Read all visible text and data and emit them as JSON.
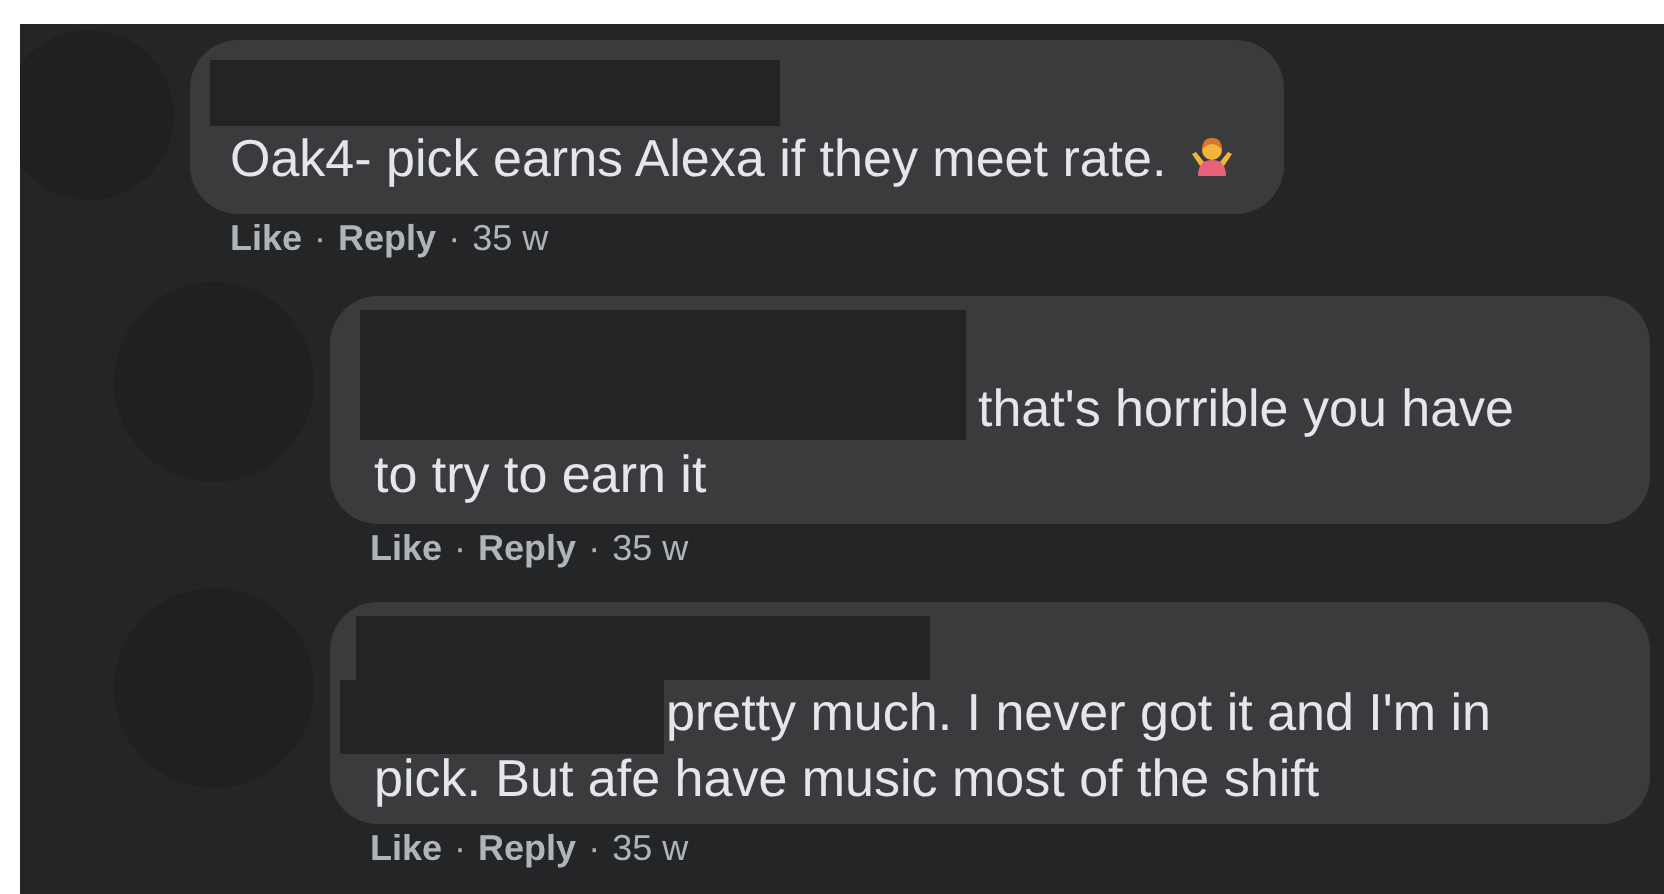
{
  "comments": [
    {
      "kind": "top",
      "redacted_name": true,
      "redacted_lead": false,
      "text": "Oak4- pick earns Alexa if they meet rate.",
      "shrug_emoji": true,
      "meta": [
        {
          "kind": "link",
          "text": "Like"
        },
        {
          "kind": "dot",
          "text": "·"
        },
        {
          "kind": "link",
          "text": "Reply"
        },
        {
          "kind": "dot",
          "text": "·"
        },
        {
          "kind": "time",
          "text": "35 w"
        }
      ]
    },
    {
      "kind": "reply",
      "redacted_name": false,
      "redacted_lead": true,
      "text": "that's horrible you have to try to earn it",
      "meta": [
        {
          "kind": "link",
          "text": "Like"
        },
        {
          "kind": "dot",
          "text": "·"
        },
        {
          "kind": "link",
          "text": "Reply"
        },
        {
          "kind": "dot",
          "text": "·"
        },
        {
          "kind": "time",
          "text": "35 w"
        }
      ]
    },
    {
      "kind": "reply",
      "redacted_name": true,
      "redacted_lead": true,
      "text": "pretty much. I never got it and I'm in pick. But afe have music most of the shift",
      "meta": [
        {
          "kind": "link",
          "text": "Like"
        },
        {
          "kind": "dot",
          "text": "·"
        },
        {
          "kind": "link",
          "text": "Reply"
        },
        {
          "kind": "dot",
          "text": "·"
        },
        {
          "kind": "time",
          "text": "35 w"
        }
      ]
    }
  ]
}
